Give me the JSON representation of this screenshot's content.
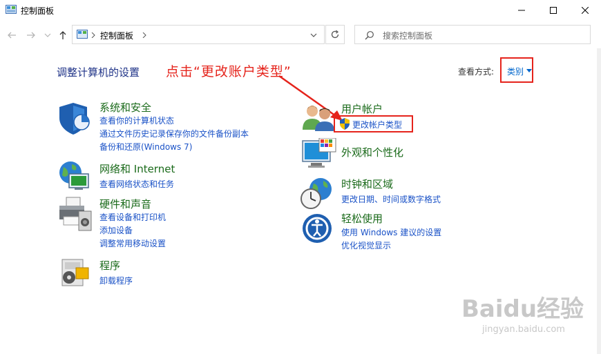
{
  "window": {
    "title": "控制面板",
    "minimize_icon": "minimize-icon",
    "maximize_icon": "maximize-icon",
    "close_icon": "close-icon"
  },
  "navigation": {
    "address": "控制面板",
    "search_placeholder": "搜索控制面板"
  },
  "header": {
    "page_title": "调整计算机的设置",
    "annotation": "点击“更改账户类型”",
    "view_by_label": "查看方式:",
    "view_by_value": "类别"
  },
  "left_categories": [
    {
      "title": "系统和安全",
      "icon": "shield-icon",
      "links": [
        "查看你的计算机状态",
        "通过文件历史记录保存你的文件备份副本",
        "备份和还原(Windows 7)"
      ]
    },
    {
      "title": "网络和 Internet",
      "icon": "network-icon",
      "links": [
        "查看网络状态和任务"
      ]
    },
    {
      "title": "硬件和声音",
      "icon": "printer-icon",
      "links": [
        "查看设备和打印机",
        "添加设备",
        "调整常用移动设置"
      ]
    },
    {
      "title": "程序",
      "icon": "programs-icon",
      "links": [
        "卸载程序"
      ]
    }
  ],
  "right_categories": [
    {
      "title": "用户帐户",
      "icon": "users-icon",
      "links": [
        "更改帐户类型"
      ]
    },
    {
      "title": "外观和个性化",
      "icon": "monitor-icon",
      "links": []
    },
    {
      "title": "时钟和区域",
      "icon": "clock-globe-icon",
      "links": [
        "更改日期、时间或数字格式"
      ]
    },
    {
      "title": "轻松使用",
      "icon": "ease-of-access-icon",
      "links": [
        "使用 Windows 建议的设置",
        "优化视觉显示"
      ]
    }
  ],
  "watermark": {
    "text": "Baidu经验",
    "sub": "jingyan.baidu.com"
  },
  "colors": {
    "accent_red": "#e5231b",
    "category_green": "#1a6a1a",
    "link_blue": "#1a52c7",
    "title_blue": "#1e3287"
  }
}
